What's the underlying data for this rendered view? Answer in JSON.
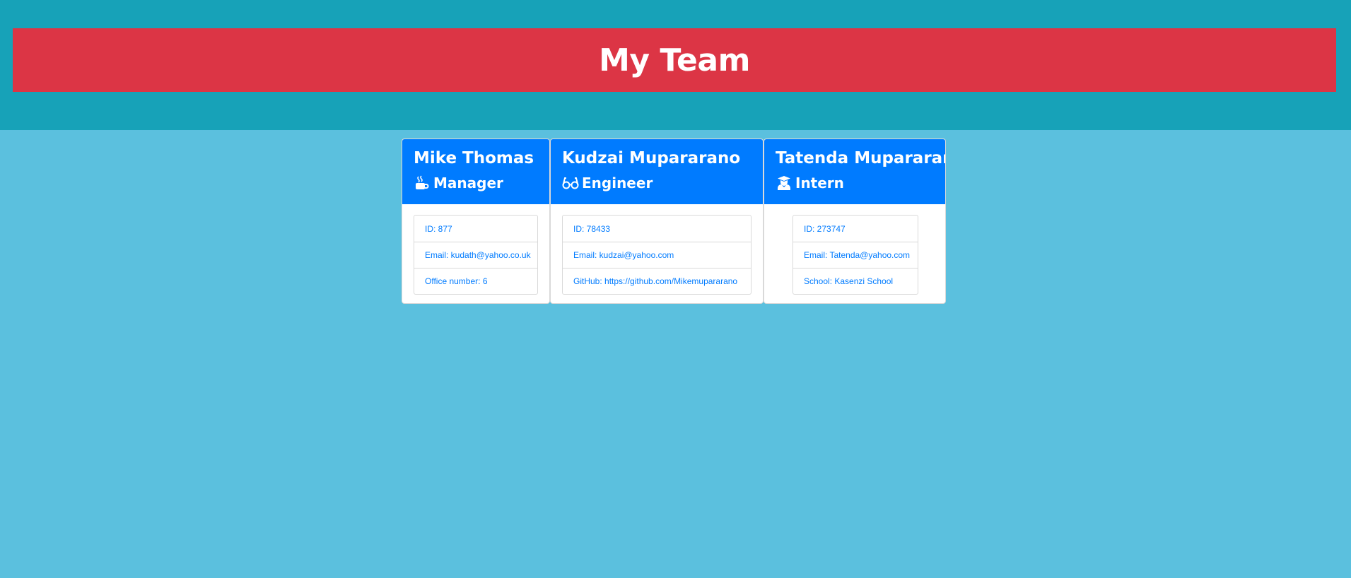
{
  "page": {
    "title": "My Team",
    "colors": {
      "jumbotron": "#17a2b8",
      "title_bar": "#dc3545",
      "background": "#5bc0de",
      "card_header": "#007bff",
      "link_text": "#007bff"
    }
  },
  "team": [
    {
      "name": "Mike Thomas",
      "role": "Manager",
      "icon": "mug-hot-icon",
      "details": [
        "ID: 877",
        "Email: kudath@yahoo.co.uk",
        "Office number: 6"
      ]
    },
    {
      "name": "Kudzai Mupararano",
      "role": "Engineer",
      "icon": "glasses-icon",
      "details": [
        "ID: 78433",
        "Email: kudzai@yahoo.com",
        "GitHub: https://github.com/Mikemupararano"
      ]
    },
    {
      "name": "Tatenda Mupararano",
      "role": "Intern",
      "icon": "user-graduate-icon",
      "details": [
        "ID: 273747",
        "Email: Tatenda@yahoo.com",
        "School: Kasenzi School"
      ]
    }
  ]
}
